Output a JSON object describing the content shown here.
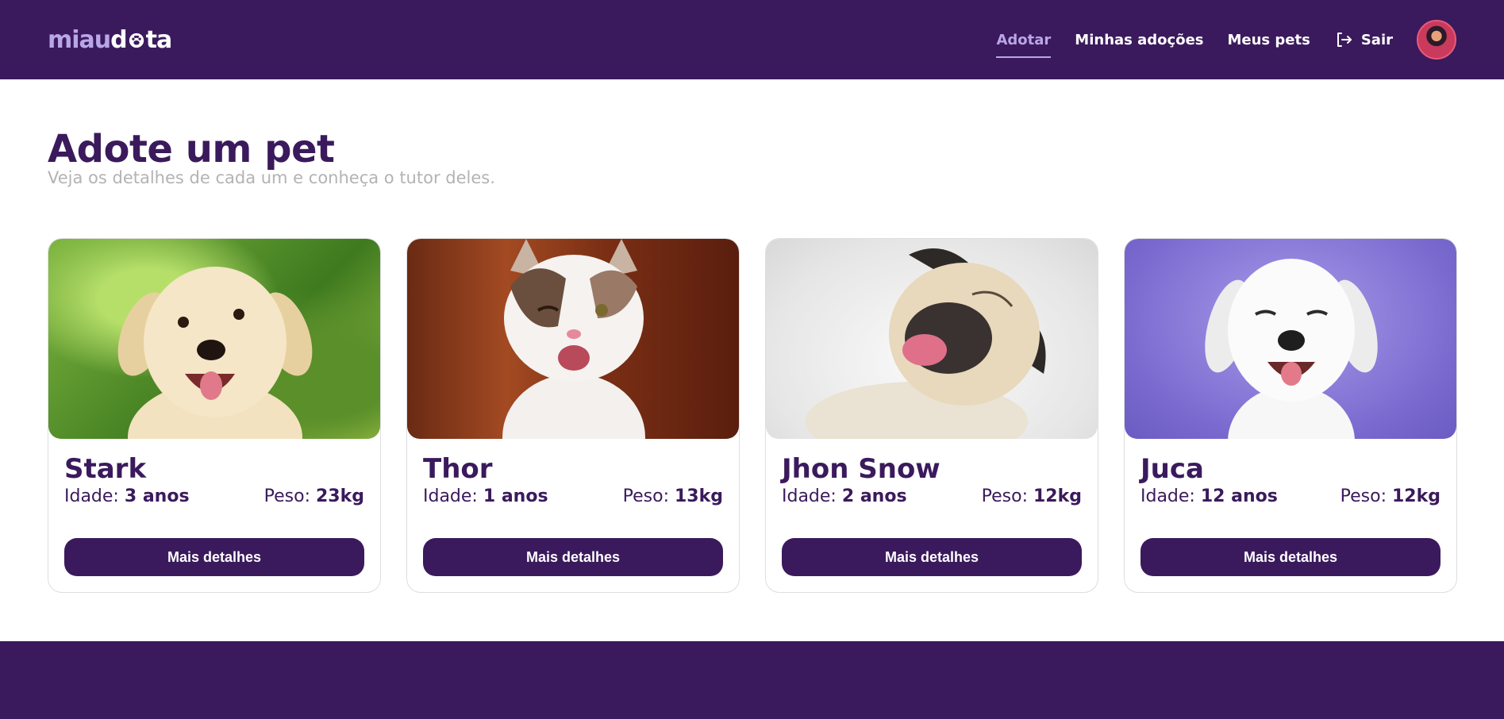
{
  "header": {
    "logo_part1": "miau",
    "logo_part2": "dota",
    "nav": [
      {
        "label": "Adotar",
        "active": true
      },
      {
        "label": "Minhas adoções",
        "active": false
      },
      {
        "label": "Meus pets",
        "active": false
      }
    ],
    "logout_label": "Sair"
  },
  "main": {
    "title": "Adote um pet",
    "subtitle": "Veja os detalhes de cada um e conheça o tutor deles."
  },
  "labels": {
    "age_label": "Idade:",
    "weight_label": "Peso:",
    "button_label": "Mais detalhes"
  },
  "pets": [
    {
      "name": "Stark",
      "age": "3 anos",
      "weight": "23kg",
      "image": "yellow-labrador-puppy"
    },
    {
      "name": "Thor",
      "age": "1 anos",
      "weight": "13kg",
      "image": "winking-calico-cat"
    },
    {
      "name": "Jhon Snow",
      "age": "2 anos",
      "weight": "12kg",
      "image": "laughing-pug"
    },
    {
      "name": "Juca",
      "age": "12 anos",
      "weight": "12kg",
      "image": "smiling-white-dog"
    }
  ],
  "colors": {
    "primary": "#3a1a5c",
    "accent": "#b9a6e6",
    "muted": "#b3b3b3"
  }
}
